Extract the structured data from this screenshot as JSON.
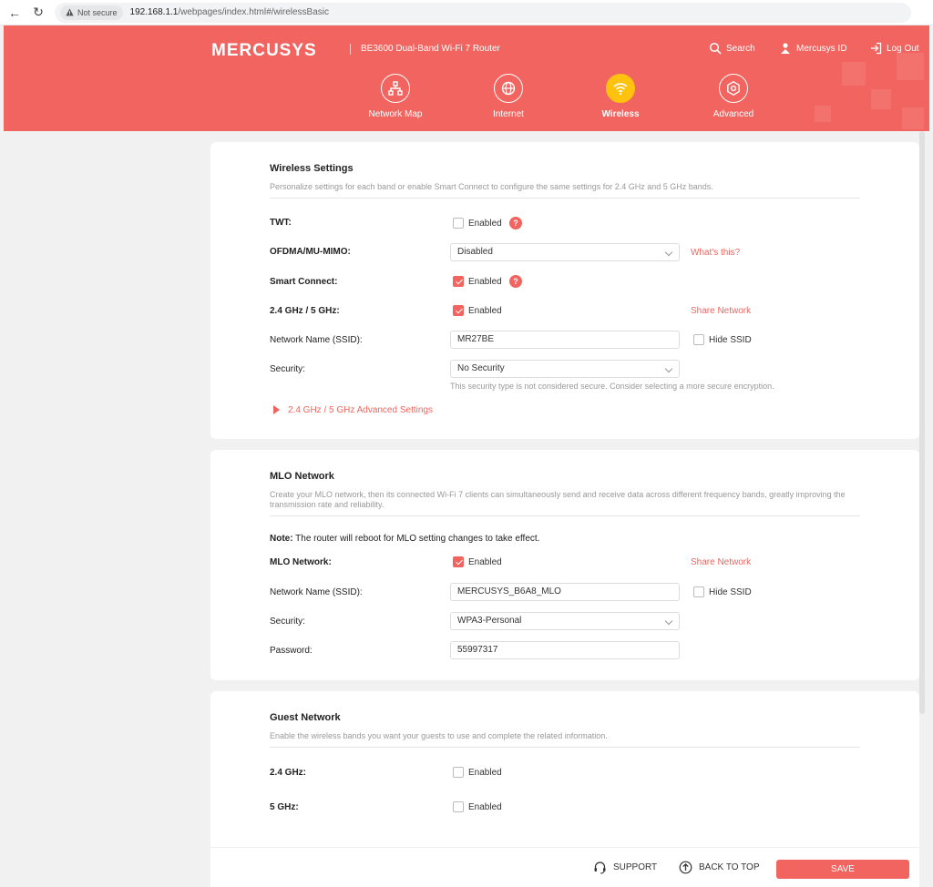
{
  "browser": {
    "back_icon": "arrow-left-icon",
    "reload_icon": "reload-icon",
    "not_secure": "Not secure",
    "url_host": "192.168.1.1",
    "url_path": "/webpages/index.html#/wirelessBasic"
  },
  "header": {
    "brand": "MERCUSYS",
    "model": "BE3600 Dual-Band Wi-Fi 7 Router",
    "search": "Search",
    "mercusys_id": "Mercusys ID",
    "logout": "Log Out",
    "tabs": [
      {
        "label": "Network Map",
        "icon": "network-map-icon"
      },
      {
        "label": "Internet",
        "icon": "globe-icon"
      },
      {
        "label": "Wireless",
        "icon": "wifi-icon",
        "active": true
      },
      {
        "label": "Advanced",
        "icon": "gear-icon"
      }
    ]
  },
  "wireless": {
    "title": "Wireless Settings",
    "desc": "Personalize settings for each band or enable Smart Connect to configure the same settings for 2.4 GHz and 5 GHz bands.",
    "twt_label": "TWT:",
    "twt_value": "Enabled",
    "twt_checked": false,
    "ofdma_label": "OFDMA/MU-MIMO:",
    "ofdma_value": "Disabled",
    "whats_this": "What's this?",
    "smart_label": "Smart Connect:",
    "smart_value": "Enabled",
    "smart_checked": true,
    "band_label": "2.4 GHz / 5 GHz:",
    "band_value": "Enabled",
    "band_checked": true,
    "share_network": "Share Network",
    "ssid_label": "Network Name (SSID):",
    "ssid_value": "MR27BE",
    "hide_ssid": "Hide SSID",
    "security_label": "Security:",
    "security_value": "No Security",
    "security_hint": "This security type is not considered secure. Consider selecting a more secure encryption.",
    "advanced_link": "2.4 GHz / 5 GHz Advanced Settings"
  },
  "mlo": {
    "title": "MLO Network",
    "desc": "Create your MLO network, then its connected Wi-Fi 7 clients can simultaneously send and receive data across different frequency bands, greatly improving the transmission rate and reliability.",
    "note_bold": "Note:",
    "note_text": " The router will reboot for MLO setting changes to take effect.",
    "mlo_label": "MLO Network:",
    "mlo_value": "Enabled",
    "mlo_checked": true,
    "share_network": "Share Network",
    "ssid_label": "Network Name (SSID):",
    "ssid_value": "MERCUSYS_B6A8_MLO",
    "hide_ssid": "Hide SSID",
    "security_label": "Security:",
    "security_value": "WPA3-Personal",
    "password_label": "Password:",
    "password_value": "55997317"
  },
  "guest": {
    "title": "Guest Network",
    "desc": "Enable the wireless bands you want your guests to use and complete the related information.",
    "g24_label": "2.4 GHz:",
    "g24_value": "Enabled",
    "g5_label": "5 GHz:",
    "g5_value": "Enabled"
  },
  "footer": {
    "support": "SUPPORT",
    "back_to_top": "BACK TO TOP",
    "save": "SAVE"
  },
  "colors": {
    "accent": "#f2645f",
    "active_tab": "#ffc20e"
  }
}
